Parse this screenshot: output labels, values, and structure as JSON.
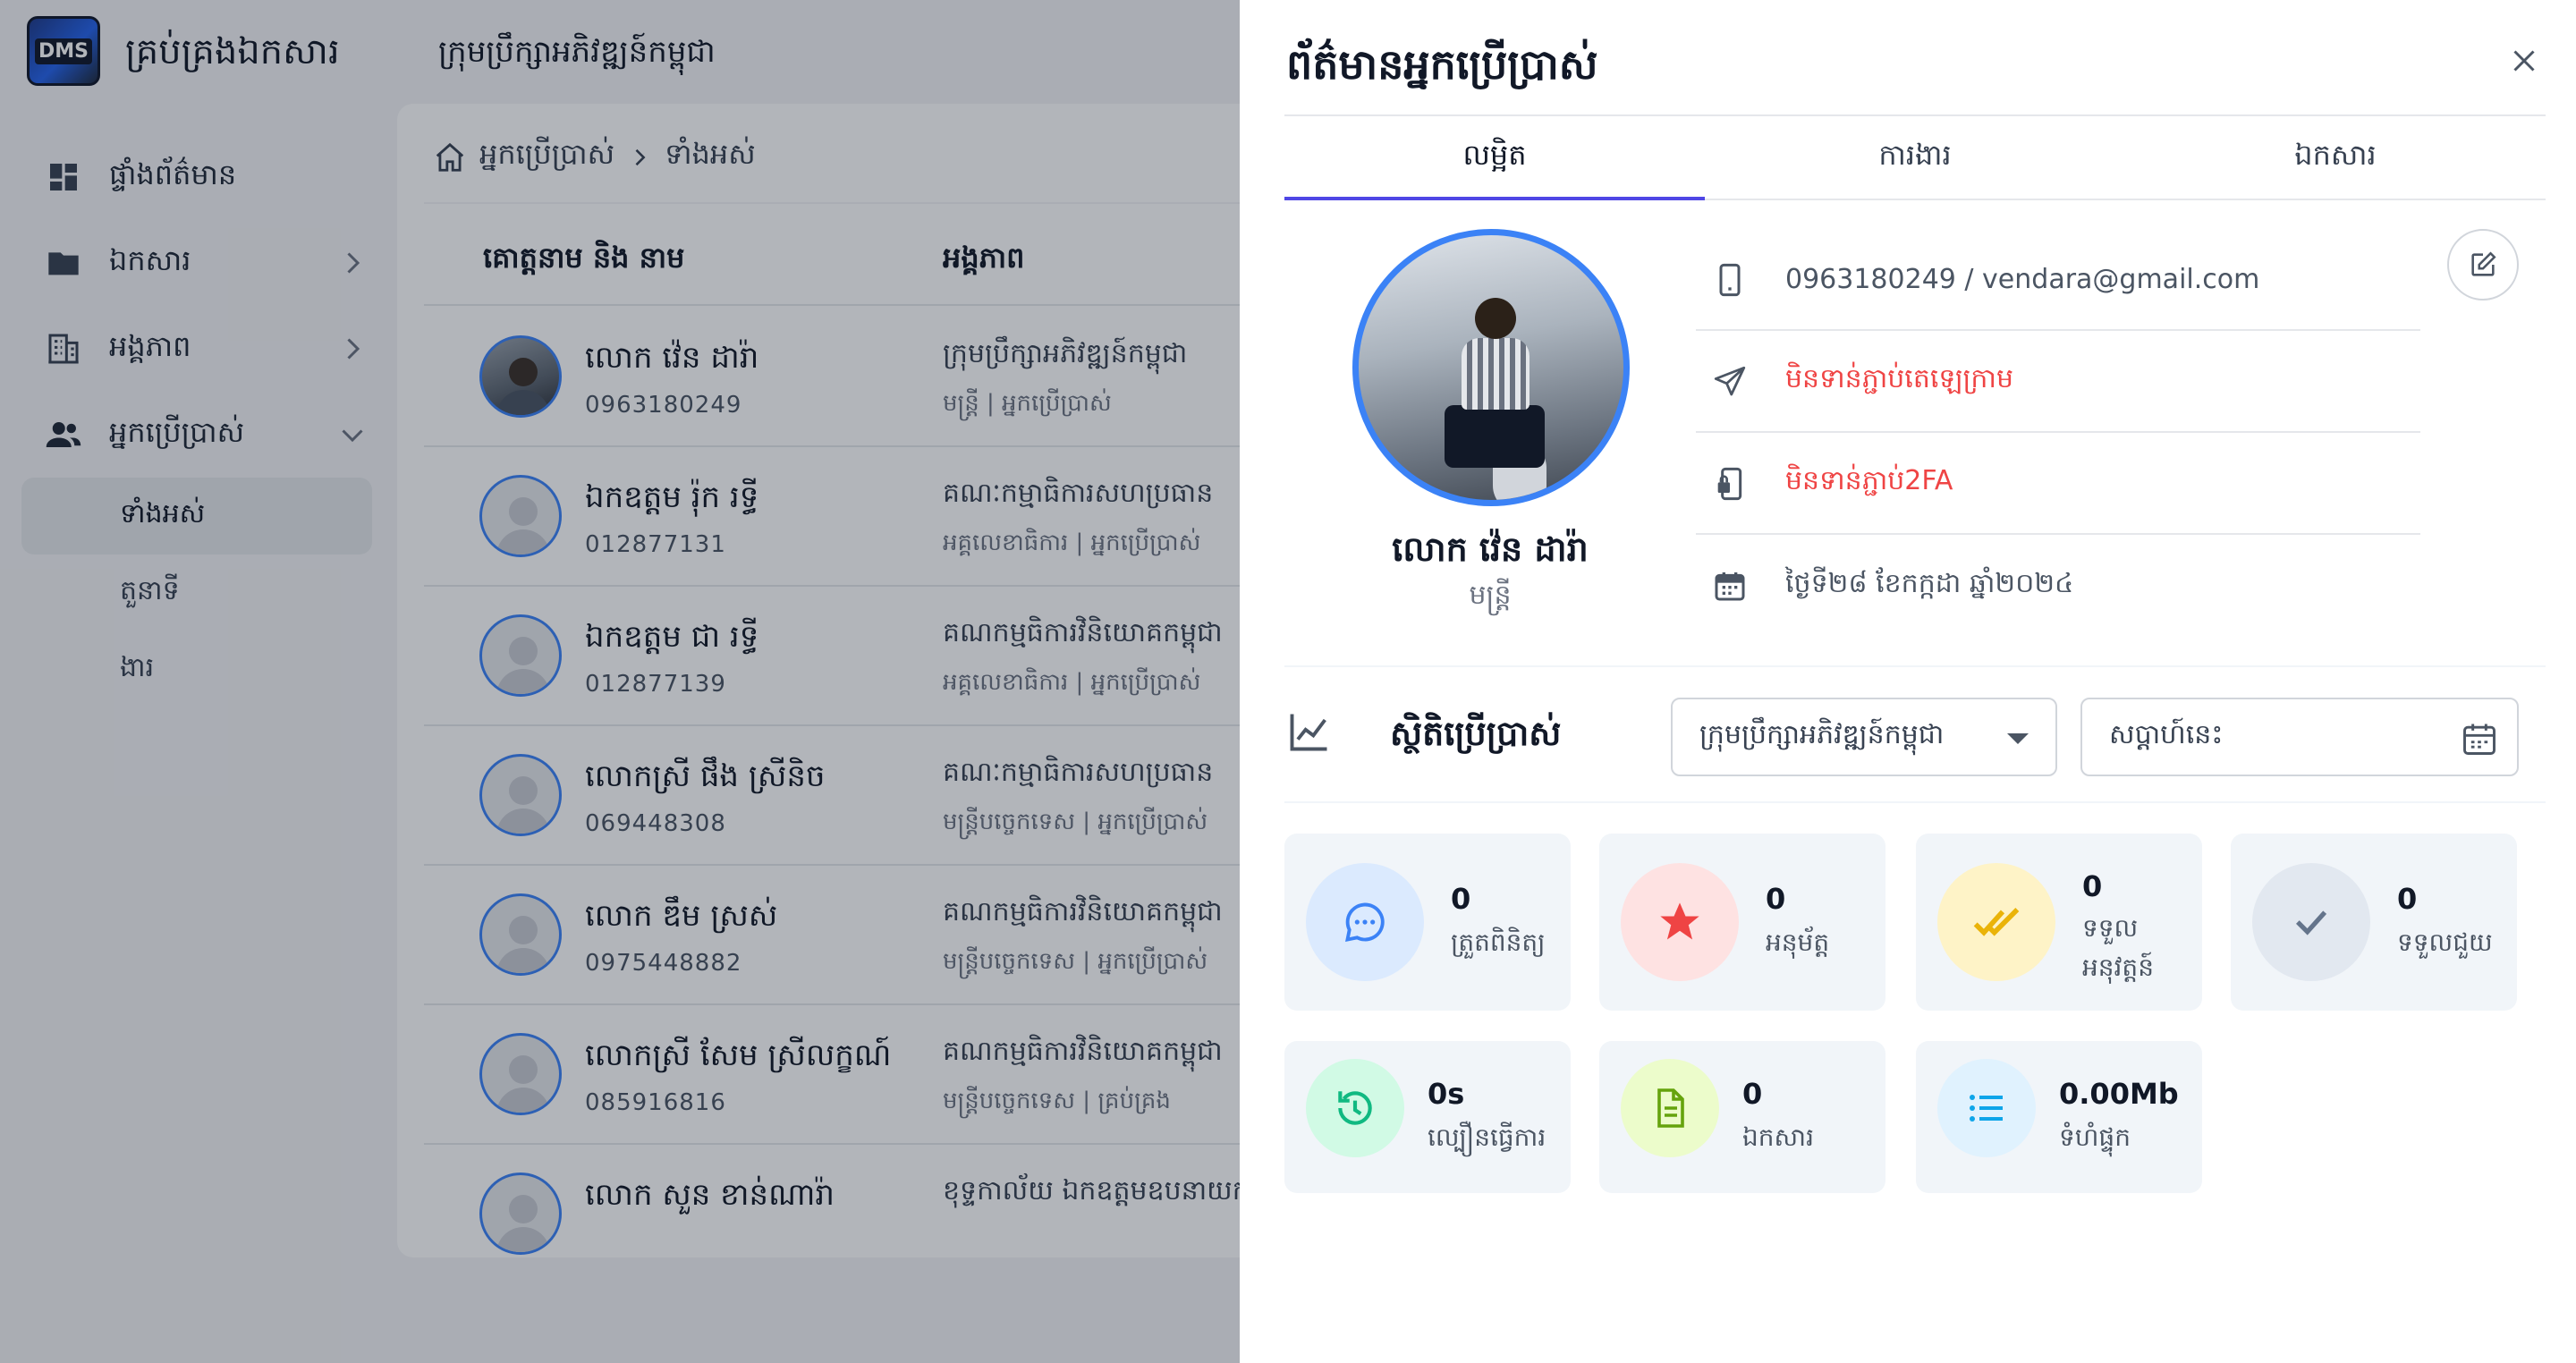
{
  "app": {
    "logo_text": "DMS",
    "title": "គ្រប់គ្រងឯកសារ",
    "org_name": "ក្រុមប្រឹក្សាអភិវឌ្ឍន៍កម្ពុជា"
  },
  "sidebar": {
    "items": [
      {
        "label": "ផ្ទាំងព័ត៌មាន",
        "icon": "dashboard-icon"
      },
      {
        "label": "ឯកសារ",
        "icon": "folder-icon"
      },
      {
        "label": "អង្គភាព",
        "icon": "building-icon"
      },
      {
        "label": "អ្នកប្រើប្រាស់",
        "icon": "users-icon"
      }
    ],
    "sub_items": [
      {
        "label": "ទាំងអស់",
        "active": true
      },
      {
        "label": "តួនាទី",
        "active": false
      },
      {
        "label": "ងារ",
        "active": false
      }
    ]
  },
  "breadcrumb": {
    "home_icon": "home-icon",
    "section": "អ្នកប្រើប្រាស់",
    "current": "ទាំងអស់"
  },
  "table": {
    "headers": [
      "គោត្តនាម និង នាម",
      "អង្គភាព"
    ],
    "rows": [
      {
        "name": "លោក វ៉េន ដារ៉ា",
        "phone": "0963180249",
        "org": "ក្រុមប្រឹក្សាអភិវឌ្ឍន៍កម្ពុជា",
        "position": "មន្ត្រី | អ្នកប្រើប្រាស់"
      },
      {
        "name": "ឯកឧត្តម រ៉ុក រទ្ធី",
        "phone": "012877131",
        "org": "គណៈកម្មាធិការសហប្រធាន",
        "position": "អគ្គលេខាធិការ | អ្នកប្រើប្រាស់"
      },
      {
        "name": "ឯកឧត្តម ជា រទ្ធី",
        "phone": "012877139",
        "org": "គណកម្មធិការវិនិយោគកម្ពុជា",
        "position": "អគ្គលេខាធិការ | អ្នកប្រើប្រាស់"
      },
      {
        "name": "លោកស្រី ផឹង ស្រីនិច",
        "phone": "069448308",
        "org": "គណៈកម្មាធិការសហប្រធាន",
        "position": "មន្ត្រីបច្ចេកទេស | អ្នកប្រើប្រាស់"
      },
      {
        "name": "លោក ឌឹម ស្រស់",
        "phone": "0975448882",
        "org": "គណកម្មធិការវិនិយោគកម្ពុជា",
        "position": "មន្ត្រីបច្ចេកទេស | អ្នកប្រើប្រាស់"
      },
      {
        "name": "លោកស្រី សែម ស្រីលក្ខណ៍",
        "phone": "085916816",
        "org": "គណកម្មធិការវិនិយោគកម្ពុជា",
        "position": "មន្ត្រីបច្ចេកទេស | គ្រប់គ្រង"
      },
      {
        "name": "លោក សួន ខាន់ណារ៉ា",
        "phone": "",
        "org": "ខុទ្ទកាល័យ ឯកឧត្តមឧបនាយករដ្ឋមន្ត្រី",
        "position": ""
      }
    ]
  },
  "drawer": {
    "title": "ព័ត៌មានអ្នកប្រើប្រាស់",
    "tabs": [
      {
        "label": "លម្អិត",
        "active": true
      },
      {
        "label": "ការងារ",
        "active": false
      },
      {
        "label": "ឯកសារ",
        "active": false
      }
    ],
    "profile": {
      "name": "លោក វ៉េន ដារ៉ា",
      "role": "មន្ត្រី"
    },
    "info": [
      {
        "icon": "phone-icon",
        "text": "0963180249 / vendara@gmail.com",
        "status": "normal"
      },
      {
        "icon": "telegram-icon",
        "text": "មិនទាន់ភ្ជាប់តេឡេក្រាម",
        "status": "warning"
      },
      {
        "icon": "lock-device-icon",
        "text": "មិនទាន់ភ្ជាប់2FA",
        "status": "warning"
      },
      {
        "icon": "calendar-icon",
        "text": "ថ្ងៃទី២៨ ខែកក្កដា ឆ្នាំ២០២៤",
        "status": "normal"
      }
    ],
    "stats": {
      "title": "ស្ថិតិប្រើប្រាស់",
      "org_select": "ក្រុមប្រឹក្សាអភិវឌ្ឍន៍កម្ពុជា",
      "date_placeholder": "សប្តាហ៍នេះ",
      "cards": [
        {
          "value": "0",
          "label": "ត្រួតពិនិត្យ",
          "icon": "chat-bubble-icon",
          "color": "#3b82f6",
          "bg": "#dbeafe"
        },
        {
          "value": "0",
          "label": "អនុម័ត្ត",
          "icon": "star-icon",
          "color": "#ef4444",
          "bg": "#fee2e2"
        },
        {
          "value": "0",
          "label": "ទទួល អនុវត្តន៍",
          "icon": "double-check-icon",
          "color": "#eab308",
          "bg": "#fef3c7"
        },
        {
          "value": "0",
          "label": "ទទួលជួយ",
          "icon": "check-icon",
          "color": "#64748b",
          "bg": "#e2e8f0"
        },
        {
          "value": "0s",
          "label": "ល្បឿនធ្វើការ",
          "icon": "history-icon",
          "color": "#10b981",
          "bg": "#d1fae5"
        },
        {
          "value": "0",
          "label": "ឯកសារ",
          "icon": "document-icon",
          "color": "#84cc16",
          "bg": "#ecfccb"
        },
        {
          "value": "0.00Mb",
          "label": "ទំហំផ្ទុក",
          "icon": "list-icon",
          "color": "#0ea5e9",
          "bg": "#e0f2fe"
        }
      ]
    }
  },
  "colors": {
    "accent": "#4f46e5",
    "avatar_border": "#3b82f6",
    "warning": "#ef4444"
  }
}
